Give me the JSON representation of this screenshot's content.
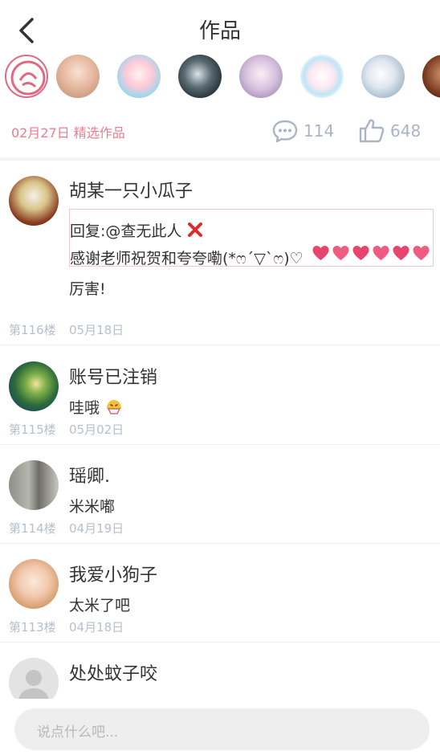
{
  "header": {
    "title": "作品",
    "back_icon": "chevron-left-icon"
  },
  "work_meta": {
    "date_label": "02月27日 精选作品",
    "comment_count": "114",
    "like_count": "648",
    "accent": "#ee7b8f"
  },
  "liker_avatars": [
    "avatar-1",
    "avatar-2",
    "avatar-3",
    "avatar-4",
    "avatar-5",
    "avatar-6",
    "avatar-7",
    "avatar-8"
  ],
  "comments": [
    {
      "user": "胡某一只小瓜子",
      "reply_to_label": "回复:@查无此人",
      "reply_text": "感谢老师祝贺和夸夸嘞(*ෆ´▽`ෆ)♡",
      "text": "厉害!",
      "floor": "第116楼",
      "date": "05月18日"
    },
    {
      "user": "账号已注销",
      "text": "哇哦",
      "floor": "第115楼",
      "date": "05月02日"
    },
    {
      "user": "瑶卿.",
      "text": "米米嘟",
      "floor": "第114楼",
      "date": "04月19日"
    },
    {
      "user": "我爱小狗子",
      "text": "太米了吧",
      "floor": "第113楼",
      "date": "04月18日"
    },
    {
      "user": "处处蚊子咬"
    }
  ],
  "input": {
    "placeholder": "说点什么吧..."
  }
}
